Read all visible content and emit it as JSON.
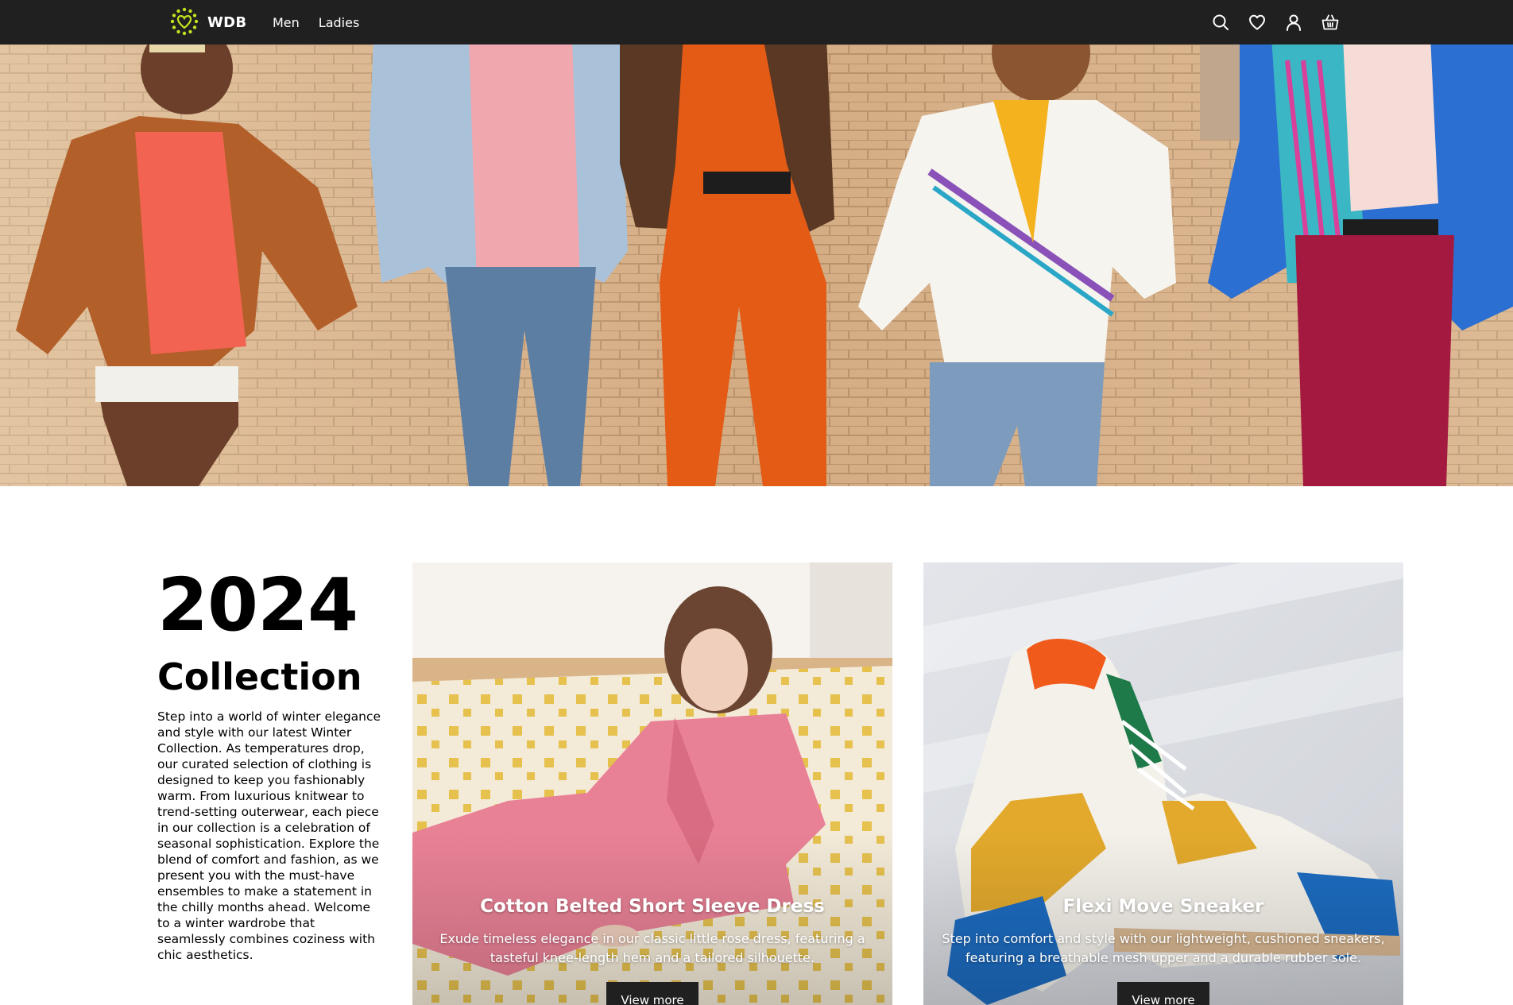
{
  "header": {
    "brand": "WDB",
    "nav": [
      {
        "label": "Men"
      },
      {
        "label": "Ladies"
      }
    ],
    "icons": [
      "search-icon",
      "heart-icon",
      "user-icon",
      "basket-icon"
    ],
    "colors": {
      "bar": "#202020",
      "logo_accent": "#c4e21f"
    }
  },
  "hero": {
    "image": "people-walking-in-colorful-outfits"
  },
  "intro": {
    "year": "2024",
    "title": "Collection",
    "description": "Step into a world of winter elegance and style with our latest Winter Collection. As temperatures drop, our curated selection of clothing is designed to keep you fashionably warm. From luxurious knitwear to trend-setting outerwear, each piece in our collection is a celebration of seasonal sophistication. Explore the blend of comfort and fashion, as we present you with the must-have ensembles to make a statement in the chilly months ahead. Welcome to a winter wardrobe that seamlessly combines coziness with chic aesthetics."
  },
  "products": [
    {
      "title": "Cotton Belted Short Sleeve Dress",
      "description": "Exude timeless elegance in our classic little rose dress, featuring a tasteful knee-length hem and a tailored silhouette.",
      "button": "View more",
      "image": "woman-in-pink-dress-on-rug"
    },
    {
      "title": "Flexi Move Sneaker",
      "description": "Step into comfort and style with our lightweight, cushioned sneakers, featuring a breathable mesh upper and a durable rubber sole.",
      "button": "View more",
      "image": "yellow-blue-sneakers"
    }
  ]
}
